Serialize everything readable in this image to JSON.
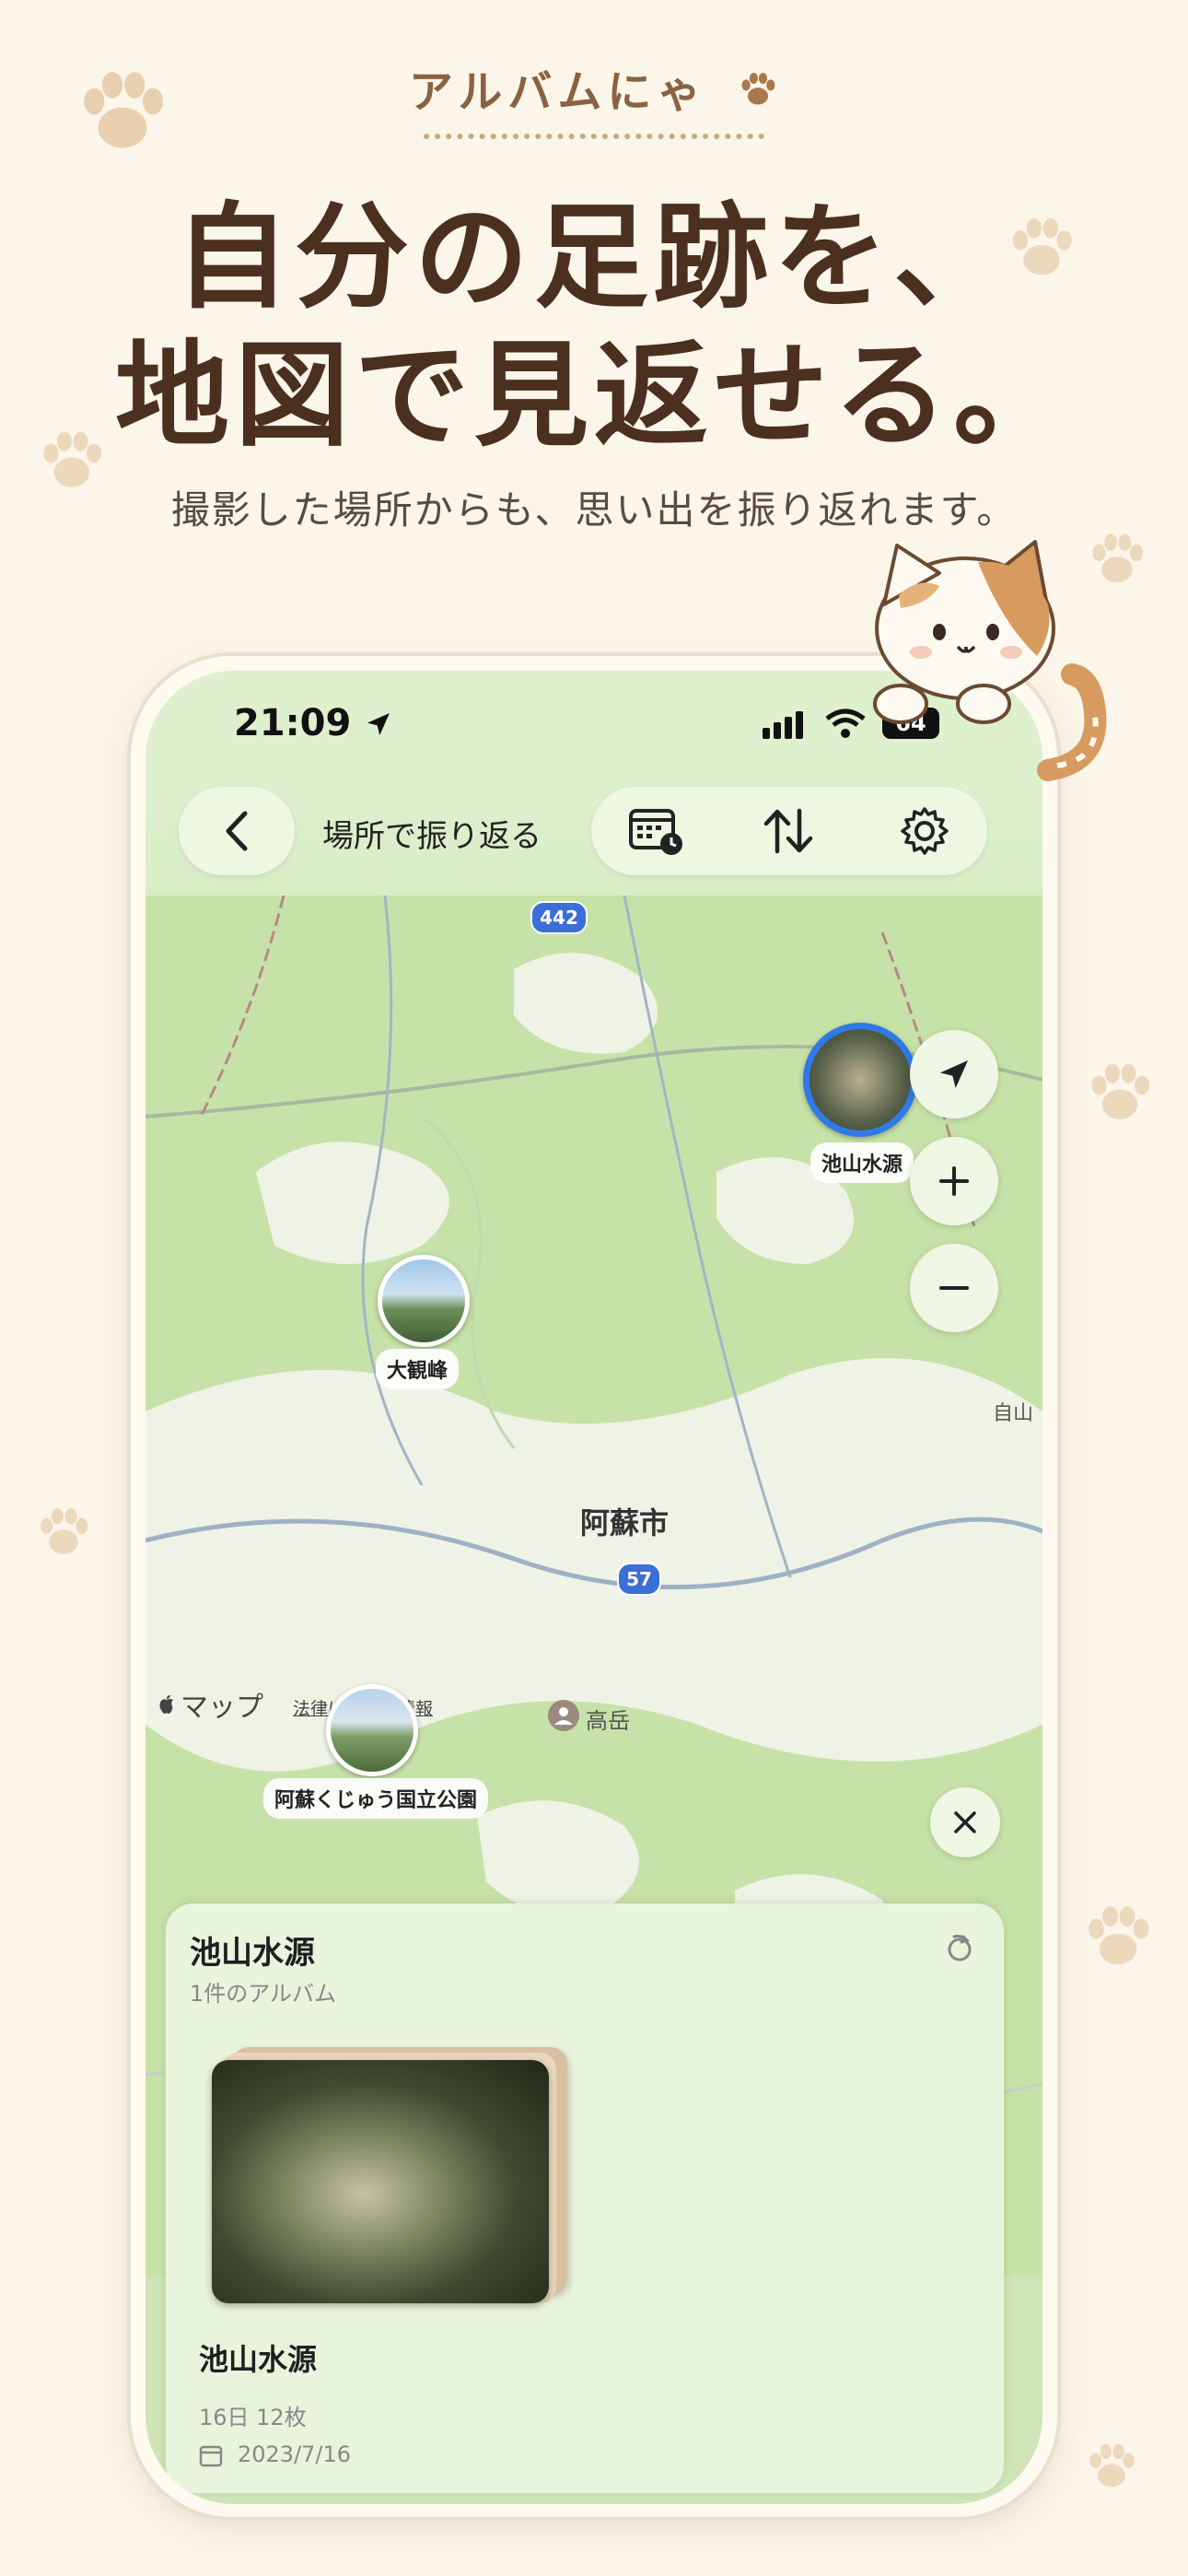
{
  "header": {
    "brand": "アルバムにゃ",
    "headline_line1": "自分の足跡を、",
    "headline_line2": "地図で見返せる。",
    "subtitle": "撮影した場所からも、思い出を振り返れます。"
  },
  "status_bar": {
    "time": "21:09",
    "battery": "64"
  },
  "toolbar": {
    "back_label": "<",
    "title": "場所で振り返る"
  },
  "map": {
    "route_badges": [
      "442",
      "57"
    ],
    "city_label": "阿蘇市",
    "place_label": "高岳",
    "edge_label": "自山",
    "attribution": "マップ",
    "legal": "法律に基づく情報",
    "pins": [
      {
        "label": "池山水源"
      },
      {
        "label": "大観峰"
      },
      {
        "label": "阿蘇くじゅう国立公園"
      }
    ]
  },
  "sheet": {
    "title": "池山水源",
    "subtitle": "1件のアルバム",
    "album": {
      "title": "池山水源",
      "meta": "16日  12枚",
      "date": "2023/7/16"
    }
  },
  "colors": {
    "accent": "#2f7ae5",
    "map_green": "#cfe5b7",
    "brand_brown": "#4b2f1f"
  }
}
